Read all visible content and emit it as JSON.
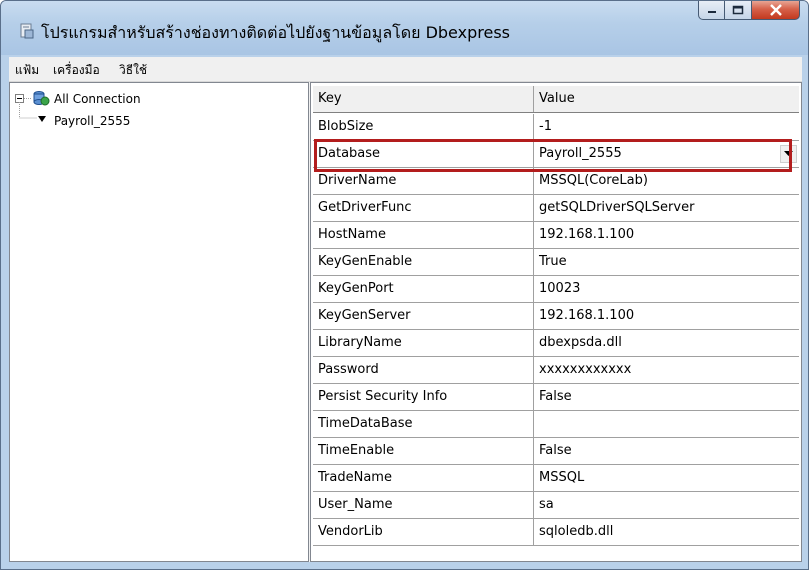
{
  "window": {
    "title": "โปรแกรมสำหรับสร้างช่องทางติดต่อไปยังฐานข้อมูลโดย Dbexpress",
    "buttons": [
      "minimize-icon",
      "maximize-icon",
      "close-icon"
    ]
  },
  "menu": {
    "items": [
      "แฟ้ม",
      "เครื่องมือ",
      "วิธีใช้"
    ]
  },
  "tree": {
    "root": "All Connection",
    "child": "Payroll_2555"
  },
  "grid": {
    "headers": {
      "key": "Key",
      "value": "Value"
    },
    "rows": [
      {
        "key": "BlobSize",
        "value": "-1"
      },
      {
        "key": "Database",
        "value": "Payroll_2555"
      },
      {
        "key": "DriverName",
        "value": "MSSQL(CoreLab)"
      },
      {
        "key": "GetDriverFunc",
        "value": "getSQLDriverSQLServer"
      },
      {
        "key": "HostName",
        "value": "192.168.1.100"
      },
      {
        "key": "KeyGenEnable",
        "value": "True"
      },
      {
        "key": "KeyGenPort",
        "value": "10023"
      },
      {
        "key": "KeyGenServer",
        "value": "192.168.1.100"
      },
      {
        "key": "LibraryName",
        "value": "dbexpsda.dll"
      },
      {
        "key": "Password",
        "value": "xxxxxxxxxxxx"
      },
      {
        "key": "Persist Security Info",
        "value": "False"
      },
      {
        "key": "TimeDataBase",
        "value": ""
      },
      {
        "key": "TimeEnable",
        "value": "False"
      },
      {
        "key": "TradeName",
        "value": "MSSQL"
      },
      {
        "key": "User_Name",
        "value": "sa"
      },
      {
        "key": "VendorLib",
        "value": "sqloledb.dll"
      }
    ]
  },
  "colors": {
    "title_bg": "#b9d1ea",
    "highlight_border": "#b31d1d",
    "close_button": "#c9442a"
  }
}
